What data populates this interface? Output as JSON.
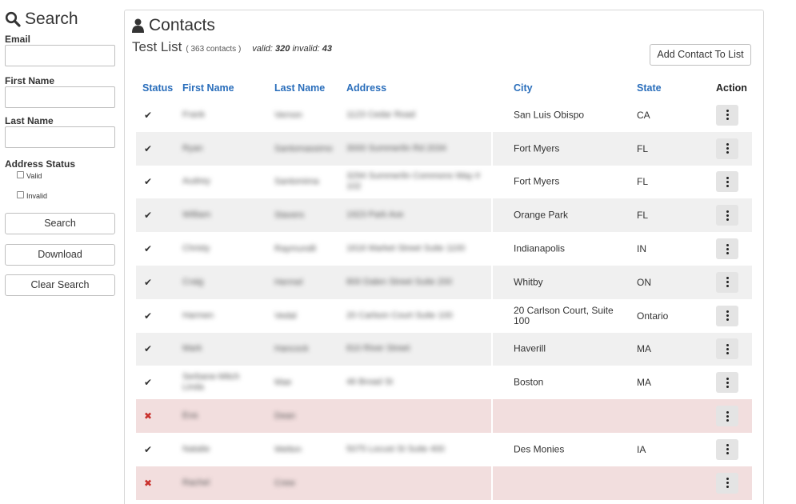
{
  "sidebar": {
    "title": "Search",
    "email_label": "Email",
    "first_name_label": "First Name",
    "last_name_label": "Last Name",
    "address_status_label": "Address Status",
    "valid_label": "Valid",
    "invalid_label": "Invalid",
    "search_button": "Search",
    "download_button": "Download",
    "clear_button": "Clear Search"
  },
  "main": {
    "title": "Contacts",
    "list_name": "Test List",
    "list_count": "( 363 contacts )",
    "valid_label": "valid:",
    "valid_count": "320",
    "invalid_label": "invalid:",
    "invalid_count": "43",
    "add_button": "Add Contact To List",
    "columns": {
      "status": "Status",
      "first_name": "First Name",
      "last_name": "Last Name",
      "address": "Address",
      "city": "City",
      "state": "State",
      "action": "Action"
    },
    "rows": [
      {
        "status": "✔",
        "first": "Frank",
        "last": "Vernon",
        "address": "1123 Cedar Road",
        "city": "San Luis Obispo",
        "state": "CA"
      },
      {
        "status": "✔",
        "first": "Ryan",
        "last": "Santomassimo",
        "address": "3000 Summerlin Rd 2034",
        "city": "Fort Myers",
        "state": "FL"
      },
      {
        "status": "✔",
        "first": "Audrey",
        "last": "Santomima",
        "address": "3294 Summerlin Commons Way #",
        "address2": "102",
        "city": "Fort Myers",
        "state": "FL"
      },
      {
        "status": "✔",
        "first": "William",
        "last": "Stavers",
        "address": "1923 Park Ave",
        "city": "Orange Park",
        "state": "FL"
      },
      {
        "status": "✔",
        "first": "Christy",
        "last": "Raymundil",
        "address": "1616 Market Street Suite 1100",
        "city": "Indianapolis",
        "state": "IN"
      },
      {
        "status": "✔",
        "first": "Craig",
        "last": "Hermel",
        "address": "800 Dalen Street Suite 200",
        "city": "Whitby",
        "state": "ON"
      },
      {
        "status": "✔",
        "first": "Harmen",
        "last": "Vedal",
        "address": "20 Carlson Court Suite 100",
        "city": "20 Carlson Court, Suite",
        "city2": "100",
        "state": "Ontario"
      },
      {
        "status": "✔",
        "first": "Mark",
        "last": "Hancock",
        "address": "810 River Street",
        "city": "Haverill",
        "state": "MA"
      },
      {
        "status": "✔",
        "first": "Serbane-Mitch",
        "first2": "Linda",
        "last": "Mae",
        "address": "46 Broad St",
        "city": "Boston",
        "state": "MA"
      },
      {
        "status": "✖",
        "first": "Eva",
        "last": "Dean",
        "address": "",
        "city": "",
        "state": ""
      },
      {
        "status": "✔",
        "first": "Natalie",
        "last": "Welton",
        "address": "5075 Locust St Suite 400",
        "city": "Des Monies",
        "state": "IA"
      },
      {
        "status": "✖",
        "first": "Rachel",
        "last": "Crew",
        "address": "",
        "city": "",
        "state": ""
      }
    ]
  },
  "colors": {
    "header_link": "#2a6ebb",
    "row_alt": "#f0f0f0",
    "row_invalid": "#f2dede",
    "invalid_mark": "#c9302c"
  }
}
